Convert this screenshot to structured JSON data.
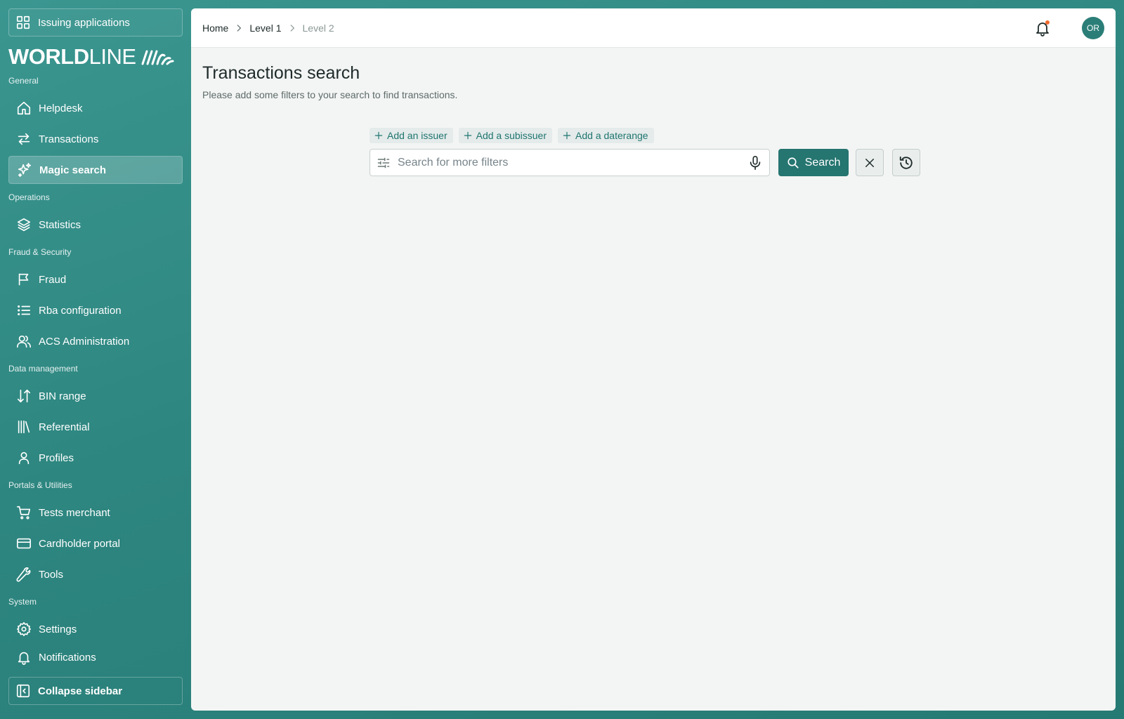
{
  "app_switcher": {
    "label": "Issuing applications",
    "icon": "grid-icon"
  },
  "logo": {
    "bold": "WORLD",
    "light": "LINE"
  },
  "sections": {
    "general": "General",
    "operations": "Operations",
    "fraud_security": "Fraud & Security",
    "data_management": "Data management",
    "portals_utilities": "Portals & Utilities",
    "system": "System"
  },
  "nav": {
    "helpdesk": "Helpdesk",
    "transactions": "Transactions",
    "magic_search": "Magic search",
    "statistics": "Statistics",
    "fraud": "Fraud",
    "rba_configuration": "Rba configuration",
    "acs_administration": "ACS Administration",
    "bin_range": "BIN range",
    "referential": "Referential",
    "profiles": "Profiles",
    "tests_merchant": "Tests merchant",
    "cardholder_portal": "Cardholder portal",
    "tools": "Tools",
    "settings": "Settings",
    "notifications": "Notifications"
  },
  "active_nav": "magic_search",
  "collapse_label": "Collapse sidebar",
  "breadcrumb": {
    "home": "Home",
    "level1": "Level 1",
    "level2": "Level 2"
  },
  "user": {
    "initials": "OR"
  },
  "page": {
    "title": "Transactions search",
    "subtitle": "Please add some filters to your search to find transactions."
  },
  "chips": {
    "issuer": "Add an issuer",
    "subissuer": "Add a subissuer",
    "daterange": "Add a daterange"
  },
  "search": {
    "placeholder": "Search for more filters",
    "value": "",
    "button_label": "Search"
  },
  "colors": {
    "brand": "#2e8680",
    "accent": "#257570",
    "notification_dot": "#f26b2e"
  }
}
